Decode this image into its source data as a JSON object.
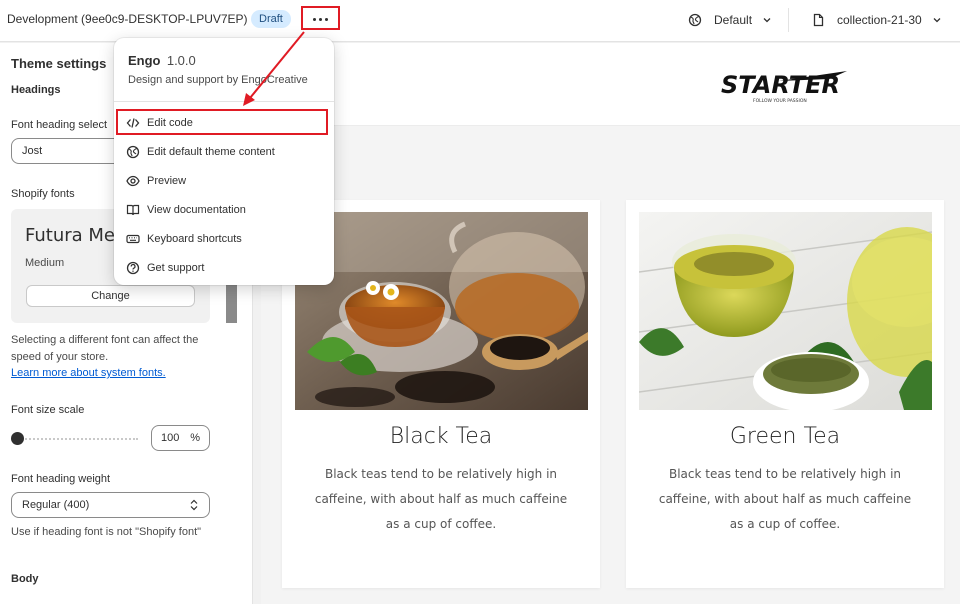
{
  "topbar": {
    "store_name": "Development (9ee0c9-DESKTOP-LPUV7EP)",
    "status_badge": "Draft",
    "theme_picker": "Default",
    "template_picker": "collection-21-30"
  },
  "sidebar": {
    "title": "Theme settings",
    "headings_section": "Headings",
    "font_heading_select_label": "Font heading select",
    "font_heading_select_value": "Jost",
    "shopify_fonts_label": "Shopify fonts",
    "font_card": {
      "name": "Futura Medium",
      "weight": "Medium",
      "change_label": "Change"
    },
    "font_help_text": "Selecting a different font can affect the speed of your store.",
    "font_help_link": "Learn more about system fonts.",
    "font_size_scale_label": "Font size scale",
    "font_size_scale_value": "100",
    "font_size_scale_unit": "%",
    "font_heading_weight_label": "Font heading weight",
    "font_heading_weight_value": "Regular (400)",
    "font_heading_weight_note": "Use if heading font is not \"Shopify font\"",
    "body_section": "Body"
  },
  "menu": {
    "app_name": "Engo",
    "app_version": "1.0.0",
    "app_support": "Design and support by EngoCreative",
    "items": [
      {
        "label": "Edit code",
        "icon": "code-icon"
      },
      {
        "label": "Edit default theme content",
        "icon": "globe-icon"
      },
      {
        "label": "Preview",
        "icon": "eye-icon"
      },
      {
        "label": "View documentation",
        "icon": "book-icon"
      },
      {
        "label": "Keyboard shortcuts",
        "icon": "keyboard-icon"
      },
      {
        "label": "Get support",
        "icon": "question-icon"
      }
    ]
  },
  "preview": {
    "logo_text": "STARTER",
    "logo_tagline": "FOLLOW YOUR PASSION",
    "products": [
      {
        "title": "Black Tea",
        "description": "Black teas tend to be relatively high in caffeine, with about half as much caffeine as a cup of coffee."
      },
      {
        "title": "Green Tea",
        "description": "Black teas tend to be relatively high in caffeine, with about half as much caffeine as a cup of coffee."
      }
    ]
  },
  "colors": {
    "highlight": "#e01b24",
    "link": "#005bd3",
    "badge_bg": "#d5ebff"
  }
}
